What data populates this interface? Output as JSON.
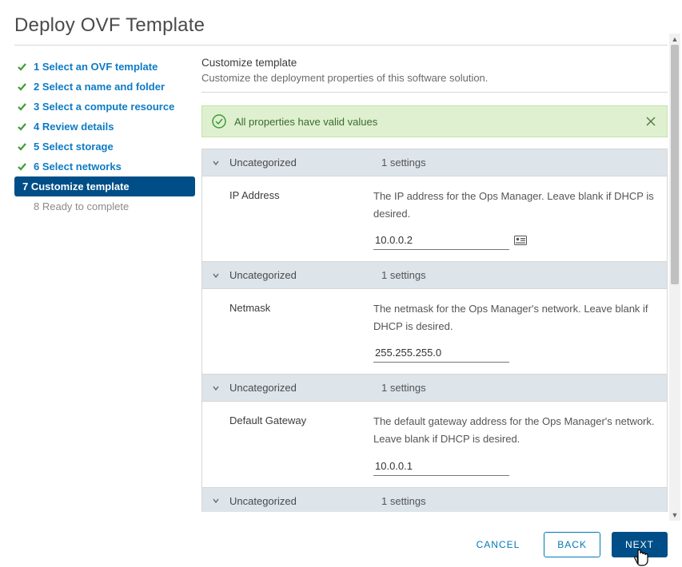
{
  "title": "Deploy OVF Template",
  "steps": [
    {
      "label": "1 Select an OVF template",
      "state": "done"
    },
    {
      "label": "2 Select a name and folder",
      "state": "done"
    },
    {
      "label": "3 Select a compute resource",
      "state": "done"
    },
    {
      "label": "4 Review details",
      "state": "done"
    },
    {
      "label": "5 Select storage",
      "state": "done"
    },
    {
      "label": "6 Select networks",
      "state": "done"
    },
    {
      "label": "7 Customize template",
      "state": "active"
    },
    {
      "label": "8 Ready to complete",
      "state": "pending"
    }
  ],
  "section": {
    "title": "Customize template",
    "subtitle": "Customize the deployment properties of this software solution."
  },
  "banner": {
    "text": "All properties have valid values"
  },
  "categories": [
    {
      "name": "Uncategorized",
      "count": "1 settings",
      "setting": {
        "name": "IP Address",
        "desc": "The IP address for the Ops Manager. Leave blank if DHCP is desired.",
        "value": "10.0.0.2",
        "has_icon": true
      }
    },
    {
      "name": "Uncategorized",
      "count": "1 settings",
      "setting": {
        "name": "Netmask",
        "desc": "The netmask for the Ops Manager's network. Leave blank if DHCP is desired.",
        "value": "255.255.255.0",
        "has_icon": false
      }
    },
    {
      "name": "Uncategorized",
      "count": "1 settings",
      "setting": {
        "name": "Default Gateway",
        "desc": "The default gateway address for the Ops Manager's network. Leave blank if DHCP is desired.",
        "value": "10.0.0.1",
        "has_icon": false
      }
    },
    {
      "name": "Uncategorized",
      "count": "1 settings",
      "setting": null
    }
  ],
  "buttons": {
    "cancel": "CANCEL",
    "back": "BACK",
    "next": "NEXT"
  }
}
